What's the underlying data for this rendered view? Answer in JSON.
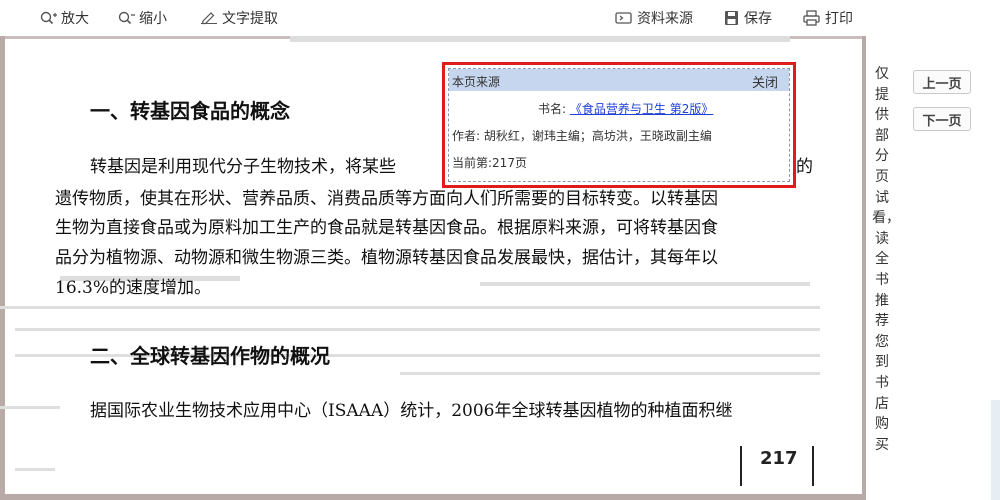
{
  "toolbar": {
    "zoom_in": "放大",
    "zoom_out": "缩小",
    "extract_text": "文字提取",
    "source": "资料来源",
    "save": "保存",
    "print": "打印"
  },
  "page": {
    "heading1": "一、转基因食品的概念",
    "paragraph1": [
      "转基因是利用现代分子生物技术，将某些",
      "遗传物质，使其在形状、营养品质、消费品质等方面向人们所需要的目标转变。以转基因",
      "生物为直接食品或为原料加工生产的食品就是转基因食品。根据原料来源，可将转基因食",
      "品分为植物源、动物源和微生物源三类。植物源转基因食品发展最快，据估计，其每年以",
      "16.3%的速度增加。"
    ],
    "paragraph1_tail": "的",
    "heading2": "二、全球转基因作物的概况",
    "paragraph2": "据国际农业生物技术应用中心（ISAAA）统计，2006年全球转基因植物的种植面积继",
    "page_number": "217"
  },
  "popup": {
    "title": "本页来源",
    "close": "关闭",
    "book_label": "书名:",
    "book_title": "《食品营养与卫生 第2版》",
    "authors": "作者: 胡秋红，谢玮主编；高坊洪，王晓政副主编",
    "current_page": "当前第:217页"
  },
  "sidebar": {
    "notice": "仅提供部分页试看，读全书推荐您到书店购买",
    "prev_page": "上一页",
    "next_page": "下一页"
  },
  "colors": {
    "popup_border": "#e01b1b",
    "popup_header": "#c5d6ee",
    "link": "#1f3fd6",
    "page_frame": "#b7aaa7"
  }
}
